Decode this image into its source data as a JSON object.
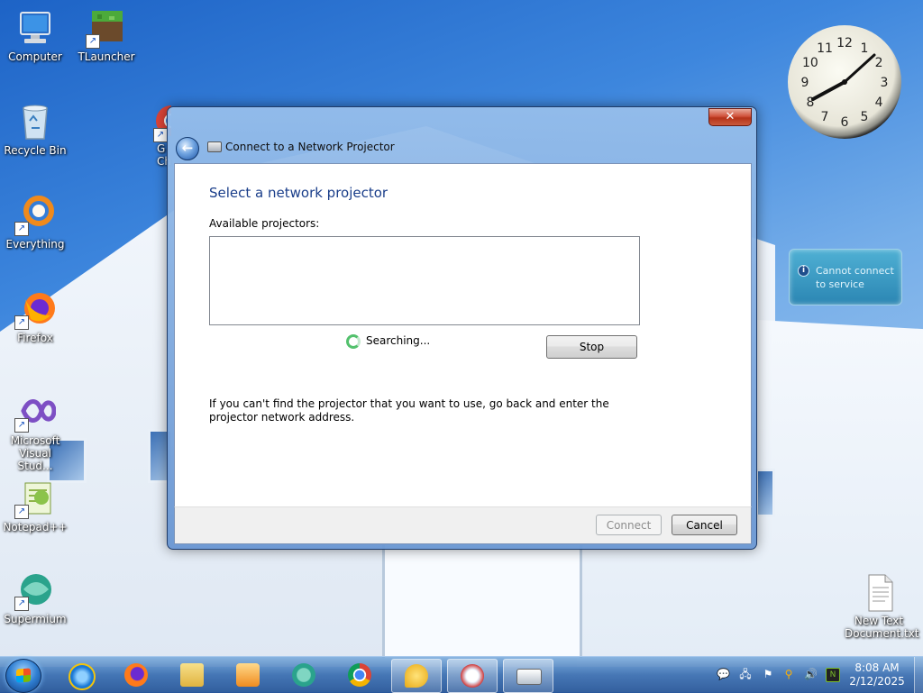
{
  "desktop": {
    "icons": [
      {
        "label": "Computer"
      },
      {
        "label": "TLauncher"
      },
      {
        "label": "Recycle Bin"
      },
      {
        "label": "Everything"
      },
      {
        "label": "Firefox"
      },
      {
        "label": "Microsoft Visual Stud..."
      },
      {
        "label": "Notepad++"
      },
      {
        "label": "Supermium"
      },
      {
        "label": "New Text Document.txt"
      }
    ],
    "partial_icon_text": "G\nCh"
  },
  "gadgets": {
    "clock": {
      "numerals": [
        "12",
        "1",
        "2",
        "3",
        "4",
        "5",
        "6",
        "7",
        "8",
        "9",
        "10",
        "11"
      ]
    },
    "notice": {
      "line1": "Cannot connect",
      "line2": "to service"
    }
  },
  "dialog": {
    "title": "Connect to a Network Projector",
    "close_glyph": "✕",
    "back_glyph": "←",
    "heading": "Select a network projector",
    "available_label": "Available projectors:",
    "status_text": "Searching...",
    "stop_label": "Stop",
    "hint": "If you can't find the projector that you want to use, go back and enter the projector network address.",
    "connect_label": "Connect",
    "cancel_label": "Cancel"
  },
  "taskbar": {
    "time": "8:08 AM",
    "date": "2/12/2025",
    "colors": {
      "accent": "#2f7ed1",
      "close": "#c9452e",
      "heading": "#1a3e8a"
    }
  }
}
